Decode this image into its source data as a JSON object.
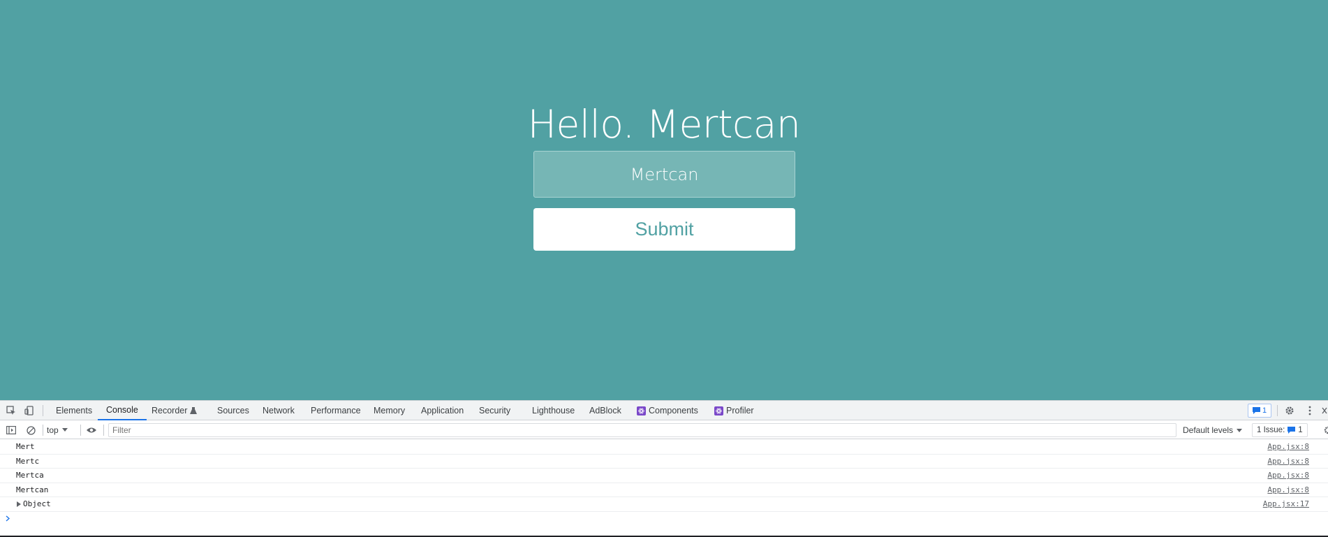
{
  "page": {
    "greeting": "Hello. Mertcan",
    "name_input_value": "Mertcan",
    "submit_label": "Submit",
    "background_color": "#51a1a3"
  },
  "devtools": {
    "tabs": [
      {
        "label": "Elements"
      },
      {
        "label": "Console",
        "active": true
      },
      {
        "label": "Recorder"
      },
      {
        "label": "Sources"
      },
      {
        "label": "Network"
      },
      {
        "label": "Performance"
      },
      {
        "label": "Memory"
      },
      {
        "label": "Application"
      },
      {
        "label": "Security"
      },
      {
        "label": "Lighthouse"
      },
      {
        "label": "AdBlock"
      },
      {
        "label": "Components"
      },
      {
        "label": "Profiler"
      }
    ],
    "issues_badge_count": "1",
    "toolbar": {
      "context": "top",
      "filter_placeholder": "Filter",
      "levels": "Default levels",
      "issues_label": "1 Issue:",
      "issues_count": "1"
    },
    "console_logs": [
      {
        "message": "Mert",
        "source": "App.jsx:8"
      },
      {
        "message": "Mertc",
        "source": "App.jsx:8"
      },
      {
        "message": "Mertca",
        "source": "App.jsx:8"
      },
      {
        "message": "Mertcan",
        "source": "App.jsx:8"
      },
      {
        "message": "Object",
        "source": "App.jsx:17",
        "expandable": true
      }
    ],
    "accent_color": "#1a73e8"
  }
}
